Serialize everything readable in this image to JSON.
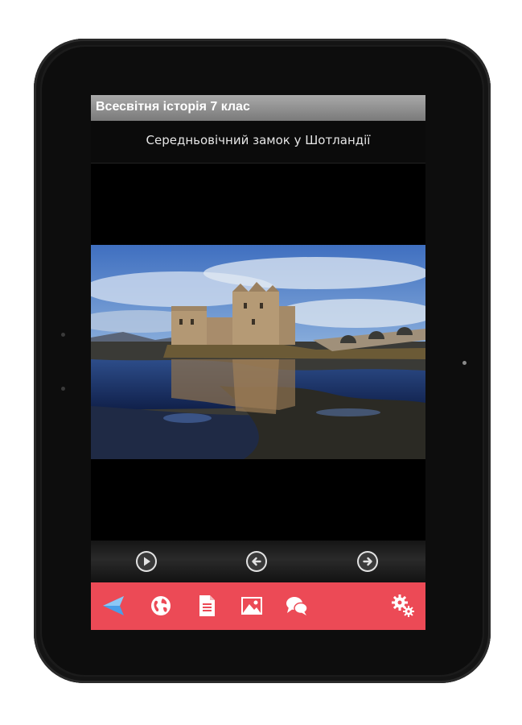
{
  "app": {
    "title": "Всесвітня історія 7 клас"
  },
  "viewer": {
    "caption": "Середньовічний замок у Шотландії"
  },
  "controls": {
    "play": "play-icon",
    "previous": "arrow-left-icon",
    "next": "arrow-right-icon"
  },
  "toolbar": {
    "items": [
      "back-icon",
      "globe-icon",
      "document-icon",
      "image-icon",
      "chat-icon",
      "settings-icon"
    ],
    "accent": "#ec4a56"
  }
}
